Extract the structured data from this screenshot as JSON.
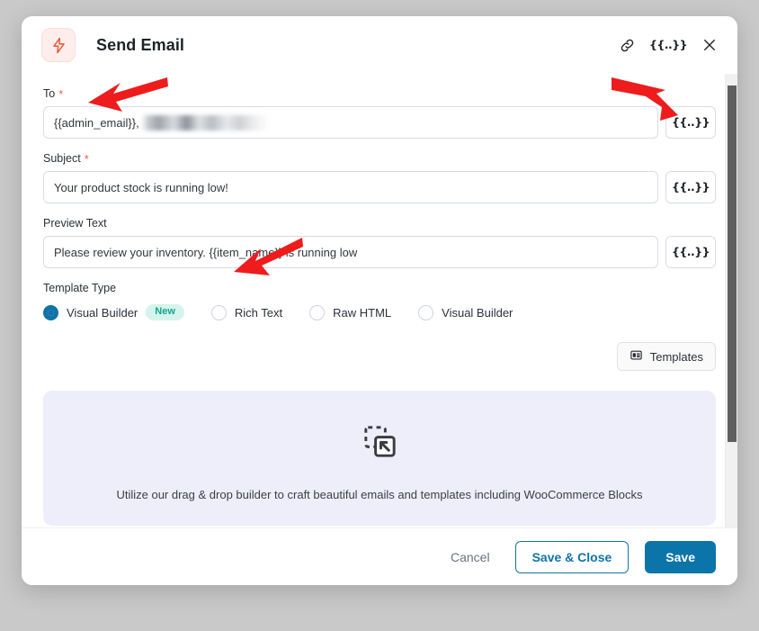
{
  "modal": {
    "title": "Send Email",
    "brand_icon": "lightning-bolt-icon",
    "header_actions": [
      {
        "name": "link-icon",
        "label": ""
      },
      {
        "name": "merge-tag-icon",
        "label": "{{..}}"
      },
      {
        "name": "close-icon",
        "label": ""
      }
    ]
  },
  "fields": {
    "to": {
      "label": "To",
      "required_marker": "*",
      "value": "{{admin_email}},",
      "redacted_note": "",
      "merge_tag_button": "{{..}}"
    },
    "subject": {
      "label": "Subject",
      "required_marker": "*",
      "value": "Your product stock is running low!",
      "merge_tag_button": "{{..}}"
    },
    "preview_text": {
      "label": "Preview Text",
      "value": "Please review your inventory. {{item_name}} is running low",
      "merge_tag_button": "{{..}}"
    }
  },
  "template_type": {
    "label": "Template Type",
    "options": [
      {
        "label": "Visual Builder",
        "selected": true,
        "badge": "New"
      },
      {
        "label": "Rich Text",
        "selected": false,
        "badge": ""
      },
      {
        "label": "Raw HTML",
        "selected": false,
        "badge": ""
      },
      {
        "label": "Visual Builder",
        "selected": false,
        "badge": ""
      }
    ]
  },
  "templates_button": {
    "label": "Templates",
    "icon": "template-grid-icon"
  },
  "promo": {
    "icon": "drag-and-drop-icon",
    "text": "Utilize our drag & drop builder to craft beautiful emails and templates including WooCommerce Blocks"
  },
  "footer": {
    "cancel_label": "Cancel",
    "save_close_label": "Save & Close",
    "save_label": "Save"
  },
  "colors": {
    "primary": "#0b74a8",
    "accent_red": "#e8604c",
    "badge_bg": "#d4f4ec",
    "badge_text": "#17a589",
    "promo_bg": "#eeeefa",
    "page_bg": "#c9c9c9",
    "annotation_arrow": "#ee1c1c"
  }
}
